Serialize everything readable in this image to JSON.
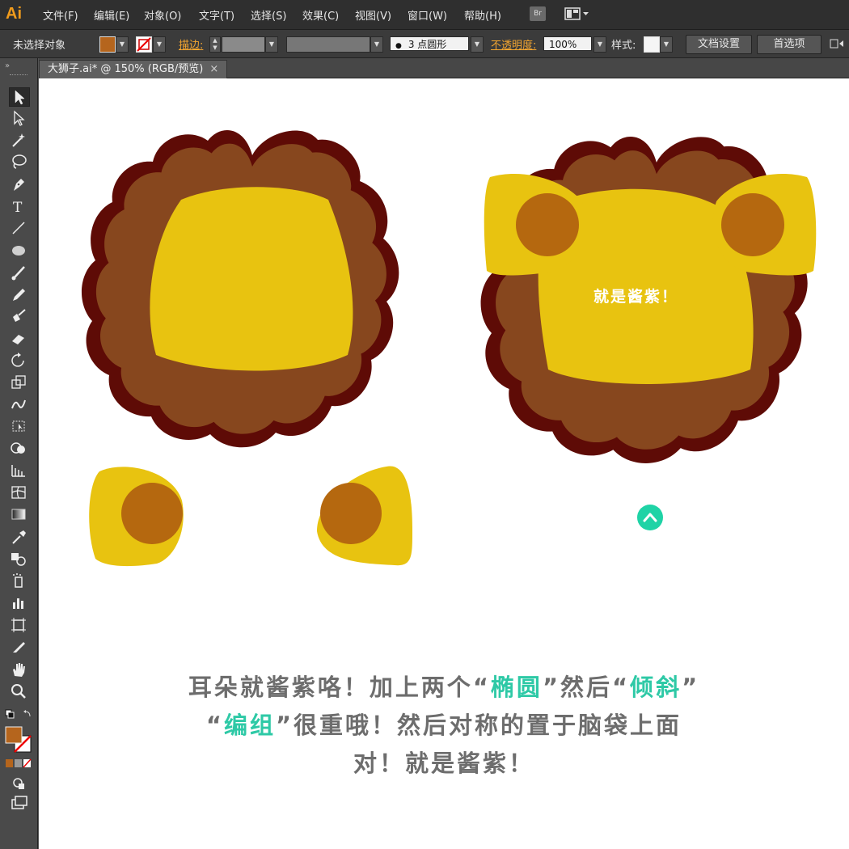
{
  "app": {
    "logo": "Ai",
    "menu": [
      "文件(F)",
      "编辑(E)",
      "对象(O)",
      "文字(T)",
      "选择(S)",
      "效果(C)",
      "视图(V)",
      "窗口(W)",
      "帮助(H)"
    ],
    "bridge_label": "Br",
    "workspace_icon": "layout-icon"
  },
  "control": {
    "selection_label": "未选择对象",
    "fill_color": "#b5651d",
    "stroke_label": "描边:",
    "brush_value": "3 点圆形",
    "opacity_label": "不透明度:",
    "opacity_value": "100%",
    "style_label": "样式:",
    "doc_setup": "文档设置",
    "preferences": "首选项"
  },
  "tab": {
    "title": "大狮子.ai* @ 150% (RGB/预览)",
    "close": "×"
  },
  "tools": [
    "selection-tool-icon",
    "direct-selection-icon",
    "magic-wand-icon",
    "lasso-icon",
    "pen-icon",
    "type-icon",
    "line-icon",
    "ellipse-icon",
    "paintbrush-icon",
    "pencil-icon",
    "blob-brush-icon",
    "eraser-icon",
    "rotate-icon",
    "scale-icon",
    "warp-icon",
    "free-transform-icon",
    "shape-builder-icon",
    "perspective-grid-icon",
    "mesh-icon",
    "gradient-icon",
    "eyedropper-icon",
    "blend-icon",
    "symbol-sprayer-icon",
    "column-graph-icon",
    "artboard-icon",
    "slice-icon",
    "hand-icon",
    "zoom-icon"
  ],
  "colors": {
    "mane_outline": "#5e0b06",
    "mane": "#87471e",
    "face": "#e8c310",
    "ear_inner": "#b5680f",
    "accent_teal": "#2ec9a6"
  },
  "canvas": {
    "head_label": "就是酱紫！",
    "caption": {
      "line1_a": "耳朵就酱紫咯！加上两个“",
      "line1_b": "椭圆",
      "line1_c": "”然后“",
      "line1_d": "倾斜",
      "line1_e": "”",
      "line2_a": "“",
      "line2_b": "编组",
      "line2_c": "”很重哦！然后对称的置于脑袋上面",
      "line3": "对！就是酱紫！"
    }
  }
}
